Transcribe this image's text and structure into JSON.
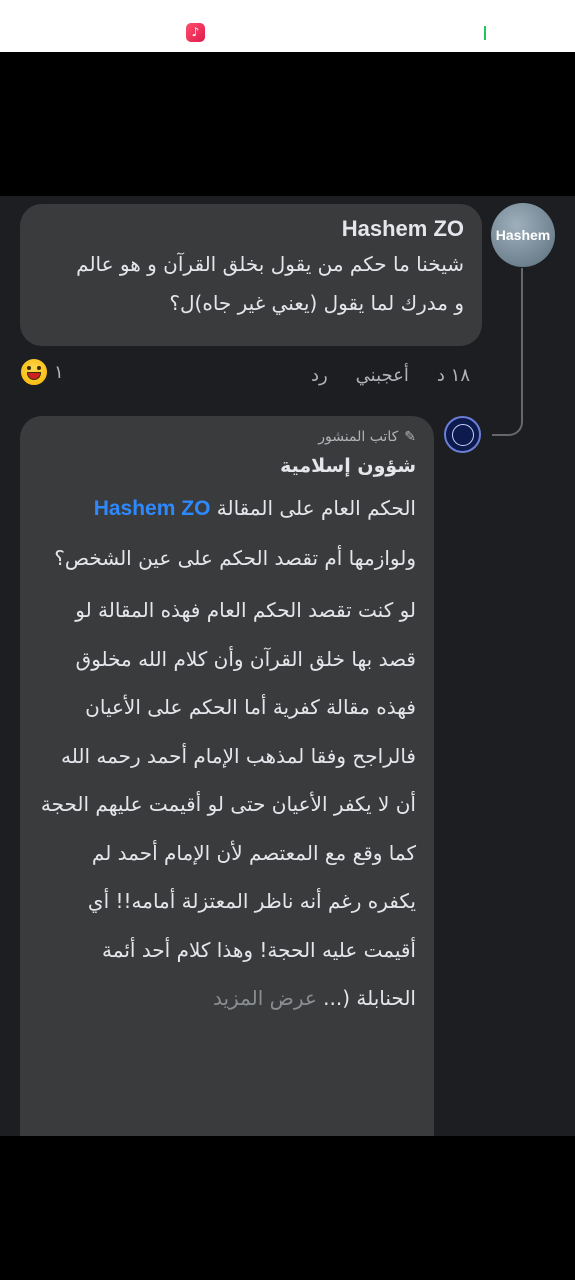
{
  "colors": {
    "background": "#1c1e21",
    "bubble": "#3a3b3c",
    "text": "#e4e6eb",
    "muted": "#b0b3b8",
    "mention": "#2e89ff"
  },
  "status_bar": {
    "icon": "music-app-icon"
  },
  "comment": {
    "avatar_label": "Hashem",
    "author": "Hashem ZO",
    "text_line_1": "شيخنا ما حكم من يقول بخلق القرآن و هو عالم",
    "text_line_2": "و مدرك لما يقول (يعني غير جاه)ل؟",
    "time": "١٨ د",
    "like_label": "أعجبني",
    "reply_label": "رد",
    "reaction_count": "١",
    "reaction_icon": "laughing-emoji-icon"
  },
  "reply": {
    "author_badge": "كاتب المنشور",
    "page_name": "شؤون إسلامية",
    "text_before_mention": "الحكم العام على المقالة ",
    "mention": "Hashem ZO",
    "text_after_mention": " ولوازمها أم تقصد الحكم على عين الشخص؟",
    "paragraph_2": "لو كنت تقصد الحكم العام فهذه المقالة لو قصد بها خلق القرآن وأن كلام الله مخلوق فهذه مقالة كفرية أما الحكم على الأعيان فالراجح وفقا لمذهب الإمام أحمد رحمه الله أن لا يكفر الأعيان حتى لو أقيمت عليهم الحجة كما وقع مع المعتصم لأن الإمام أحمد لم يكفره رغم أنه ناظر المعتزلة أمامه!! أي أقيمت عليه الحجة! وهذا كلام أحد أئمة الحنابلة (...",
    "see_more": "عرض المزيد"
  }
}
